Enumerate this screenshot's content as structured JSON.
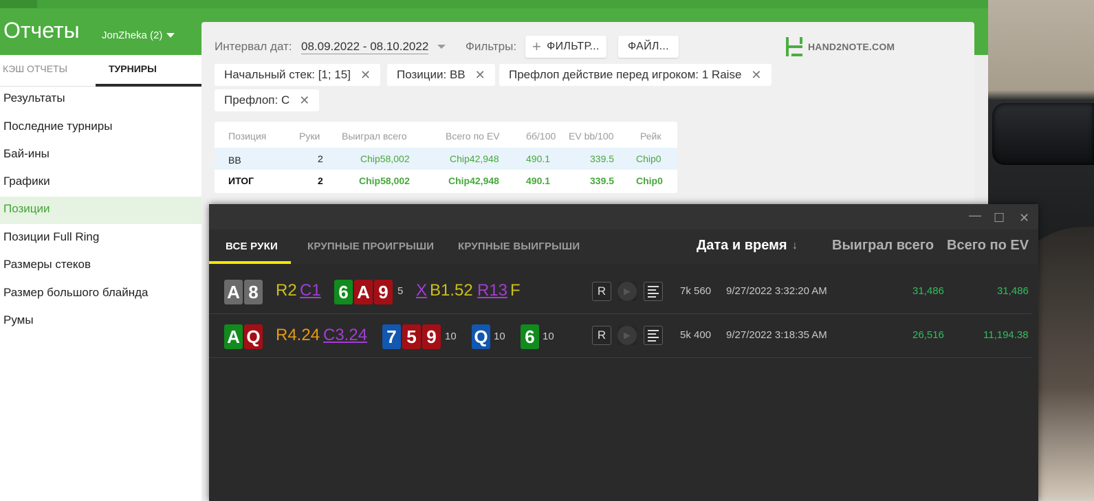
{
  "app": {
    "title": "Отчеты",
    "user": "JonZheka (2)"
  },
  "sidebar": {
    "tabs": [
      {
        "label": "КЭШ ОТЧЕТЫ"
      },
      {
        "label": "ТУРНИРЫ"
      }
    ],
    "items": [
      {
        "label": "Результаты"
      },
      {
        "label": "Последние турниры"
      },
      {
        "label": "Бай-ины"
      },
      {
        "label": "Графики"
      },
      {
        "label": "Позиции"
      },
      {
        "label": "Позиции Full Ring"
      },
      {
        "label": "Размеры стеков"
      },
      {
        "label": "Размер большого блайнда"
      },
      {
        "label": "Румы"
      }
    ]
  },
  "filters": {
    "date_label": "Интервал дат:",
    "date_value": "08.09.2022 - 08.10.2022",
    "filters_label": "Фильтры:",
    "filter_button": "ФИЛЬТР...",
    "file_button": "ФАЙЛ...",
    "logo": "HAND2NOTE.COM",
    "chips": [
      "Начальный стек: [1; 15]",
      "Позиции: BB",
      "Префлоп действие перед игроком: 1 Raise",
      "Префлоп: C"
    ]
  },
  "stats": {
    "headers": [
      "Позиция",
      "Руки",
      "Выиграл всего",
      "Всего по EV",
      "бб/100",
      "EV bb/100",
      "Рейк"
    ],
    "rows": [
      [
        "BB",
        "2",
        "Chip58,002",
        "Chip42,948",
        "490.1",
        "339.5",
        "Chip0"
      ],
      [
        "ИТОГ",
        "2",
        "Chip58,002",
        "Chip42,948",
        "490.1",
        "339.5",
        "Chip0"
      ]
    ]
  },
  "hands": {
    "window_buttons": [
      "—",
      "☐",
      "✕"
    ],
    "tabs": [
      "ВСЕ РУКИ",
      "КРУПНЫЕ ПРОИГРЫШИ",
      "КРУПНЫЕ ВЫИГРЫШИ"
    ],
    "columns": [
      "Дата и время",
      "↓",
      "Выиграл всего",
      "Всего по EV"
    ],
    "rows": [
      {
        "hole": [
          "A",
          "8"
        ],
        "preflop": [
          "R2",
          "C1"
        ],
        "flop": [
          "6",
          "A",
          "9"
        ],
        "flop_pot": "5",
        "flop_actions": [
          "X",
          "B1.52",
          "R13",
          "F"
        ],
        "btn_r": "R",
        "stack": "7k 560",
        "datetime": "9/27/2022 3:32:20 AM",
        "won": "31,486",
        "ev": "31,486"
      },
      {
        "hole": [
          "A",
          "Q"
        ],
        "preflop": [
          "R4.24",
          "C3.24"
        ],
        "flop": [
          "7",
          "5",
          "9"
        ],
        "flop_pot": "10",
        "turn": "Q",
        "turn_pot": "10",
        "river": "6",
        "river_pot": "10",
        "btn_r": "R",
        "stack": "5k 400",
        "datetime": "9/27/2022 3:18:35 AM",
        "won": "26,516",
        "ev": "11,194.38"
      }
    ]
  },
  "colors": {
    "brand_green": "#4dad41",
    "accent_yellow": "#f5e800",
    "positive": "#2fbf5d"
  }
}
